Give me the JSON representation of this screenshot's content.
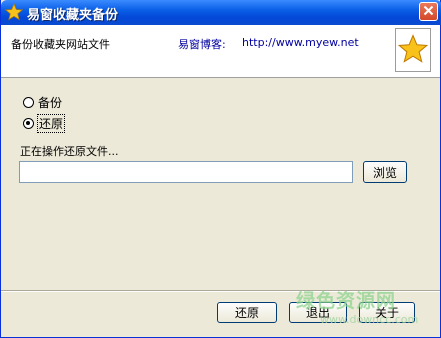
{
  "window": {
    "title": "易窗收藏夹备份",
    "title_icon": "star-icon",
    "close_icon": "close-icon"
  },
  "header": {
    "subtitle": "备份收藏夹网站文件",
    "blog_label": "易窗博客:",
    "blog_url": "http://www.myew.net",
    "logo_icon": "star-icon"
  },
  "options": [
    {
      "label": "备份",
      "selected": false
    },
    {
      "label": "还原",
      "selected": true
    }
  ],
  "status": "正在操作还原文件...",
  "path_input": {
    "value": "",
    "placeholder": ""
  },
  "browse_label": "浏览",
  "footer": {
    "restore_label": "还原",
    "exit_label": "退出",
    "about_label": "关于"
  },
  "watermark": {
    "text": "绿色资源网",
    "url": "www.downcc.com"
  },
  "colors": {
    "title_bar": "#0a5fe6",
    "window_bg": "#ece9d8",
    "link_text": "#0000a0",
    "star": "#f8c21a"
  }
}
